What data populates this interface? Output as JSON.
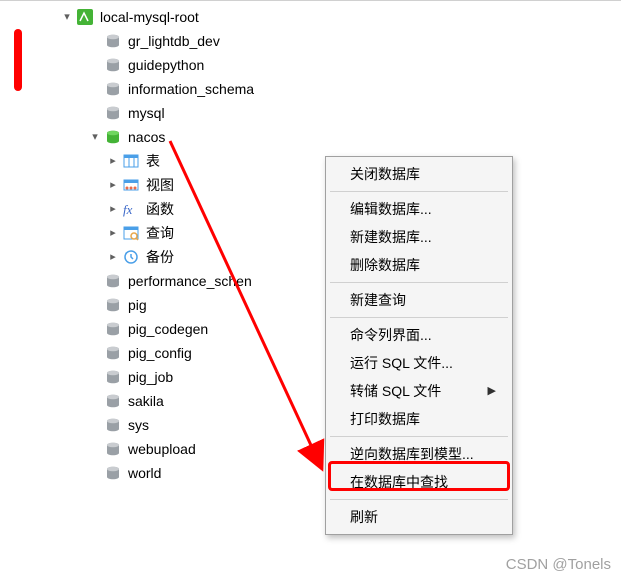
{
  "connection": {
    "name": "local-mysql-root"
  },
  "databases": [
    {
      "name": "gr_lightdb_dev",
      "expanded": false
    },
    {
      "name": "guidepython",
      "expanded": false
    },
    {
      "name": "information_schema",
      "expanded": false
    },
    {
      "name": "mysql",
      "expanded": false
    },
    {
      "name": "nacos",
      "expanded": true,
      "selected": true
    },
    {
      "name": "performance_schema",
      "expanded": false,
      "truncated": "performance_schen"
    },
    {
      "name": "pig",
      "expanded": false
    },
    {
      "name": "pig_codegen",
      "expanded": false
    },
    {
      "name": "pig_config",
      "expanded": false
    },
    {
      "name": "pig_job",
      "expanded": false
    },
    {
      "name": "sakila",
      "expanded": false
    },
    {
      "name": "sys",
      "expanded": false
    },
    {
      "name": "webupload",
      "expanded": false
    },
    {
      "name": "world",
      "expanded": false
    }
  ],
  "nacos_children": {
    "tables": "表",
    "views": "视图",
    "functions": "函数",
    "queries": "查询",
    "backups": "备份"
  },
  "context_menu": {
    "close_db": "关闭数据库",
    "edit_db": "编辑数据库...",
    "new_db": "新建数据库...",
    "delete_db": "删除数据库",
    "new_query": "新建查询",
    "cmd_line": "命令列界面...",
    "run_sql": "运行 SQL 文件...",
    "dump_sql": "转储 SQL 文件",
    "print_db": "打印数据库",
    "reverse_to_model": "逆向数据库到模型...",
    "find_in_db": "在数据库中查找",
    "refresh": "刷新"
  },
  "watermark": "CSDN @Tonels",
  "colors": {
    "accent_red": "#ff0000",
    "selection": "#cce8ff",
    "db_active": "#44b336",
    "db_inactive": "#9aa0a6"
  }
}
